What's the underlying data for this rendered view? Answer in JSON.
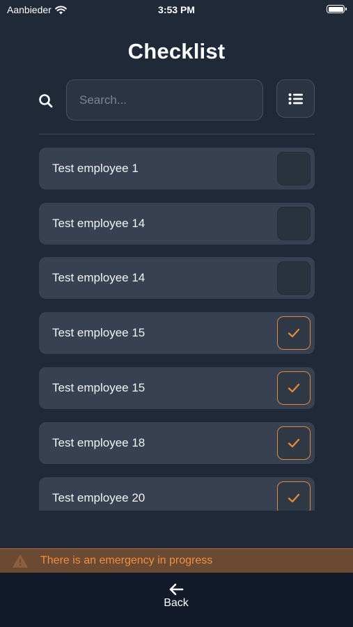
{
  "status_bar": {
    "carrier": "Aanbieder",
    "time": "3:53 PM"
  },
  "page": {
    "title": "Checklist"
  },
  "search": {
    "placeholder": "Search...",
    "value": ""
  },
  "checklist": {
    "items": [
      {
        "label": "Test employee 1",
        "checked": false
      },
      {
        "label": "Test employee 14",
        "checked": false
      },
      {
        "label": "Test employee 14",
        "checked": false
      },
      {
        "label": "Test employee 15",
        "checked": true
      },
      {
        "label": "Test employee 15",
        "checked": true
      },
      {
        "label": "Test employee 18",
        "checked": true
      },
      {
        "label": "Test employee 20",
        "checked": true
      }
    ]
  },
  "emergency": {
    "message": "There is an emergency in progress"
  },
  "nav": {
    "back_label": "Back"
  },
  "icons": {
    "search": "search-icon",
    "filter": "list-icon",
    "check": "checkmark-icon",
    "warning": "warning-triangle-icon",
    "back": "arrow-left-icon"
  },
  "colors": {
    "background": "#1f2937",
    "row": "#374151",
    "accent": "#e3893b",
    "banner": "#6b4a33",
    "bottom_bar": "#121a2a"
  }
}
